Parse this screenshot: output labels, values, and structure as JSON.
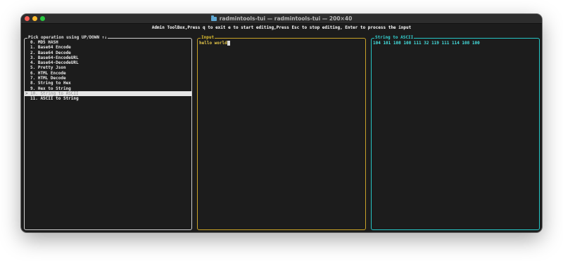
{
  "window": {
    "title": "radmintools-tui — radmintools-tui — 200×40"
  },
  "header": {
    "instructions": "Admin ToolBox,Press q to exit e to start editing,Press Esc to stop editing, Enter to process the input"
  },
  "operations_panel": {
    "title": "Pick operation using UP/DOWN ↑↓",
    "items": [
      {
        "label": "0. MD5 HASH"
      },
      {
        "label": "1. Base64 Encode"
      },
      {
        "label": "2. Base64 Decode"
      },
      {
        "label": "3. Base64-EncodeURL"
      },
      {
        "label": "4. Base64-DecodeURL"
      },
      {
        "label": "5. Pretty Json"
      },
      {
        "label": "6. HTML Encode"
      },
      {
        "label": "7. HTML Decode"
      },
      {
        "label": "8. String to Hex"
      },
      {
        "label": "9. Hex to String"
      },
      {
        "label": "10. String to ASCII"
      },
      {
        "label": "11. ASCII to String"
      }
    ],
    "selected_index": 10,
    "selected_marker": ">"
  },
  "input_panel": {
    "title": "Input",
    "value": "hello world"
  },
  "output_panel": {
    "title": "String to ASCII",
    "value": "104 101 108 108 111 32 119 111 114 108 100"
  },
  "colors": {
    "background": "#1c1c1c",
    "list_border": "#d0d0d0",
    "input_accent": "#c9a227",
    "output_accent": "#26c6c6",
    "selected_row": "#e6e6e6"
  }
}
